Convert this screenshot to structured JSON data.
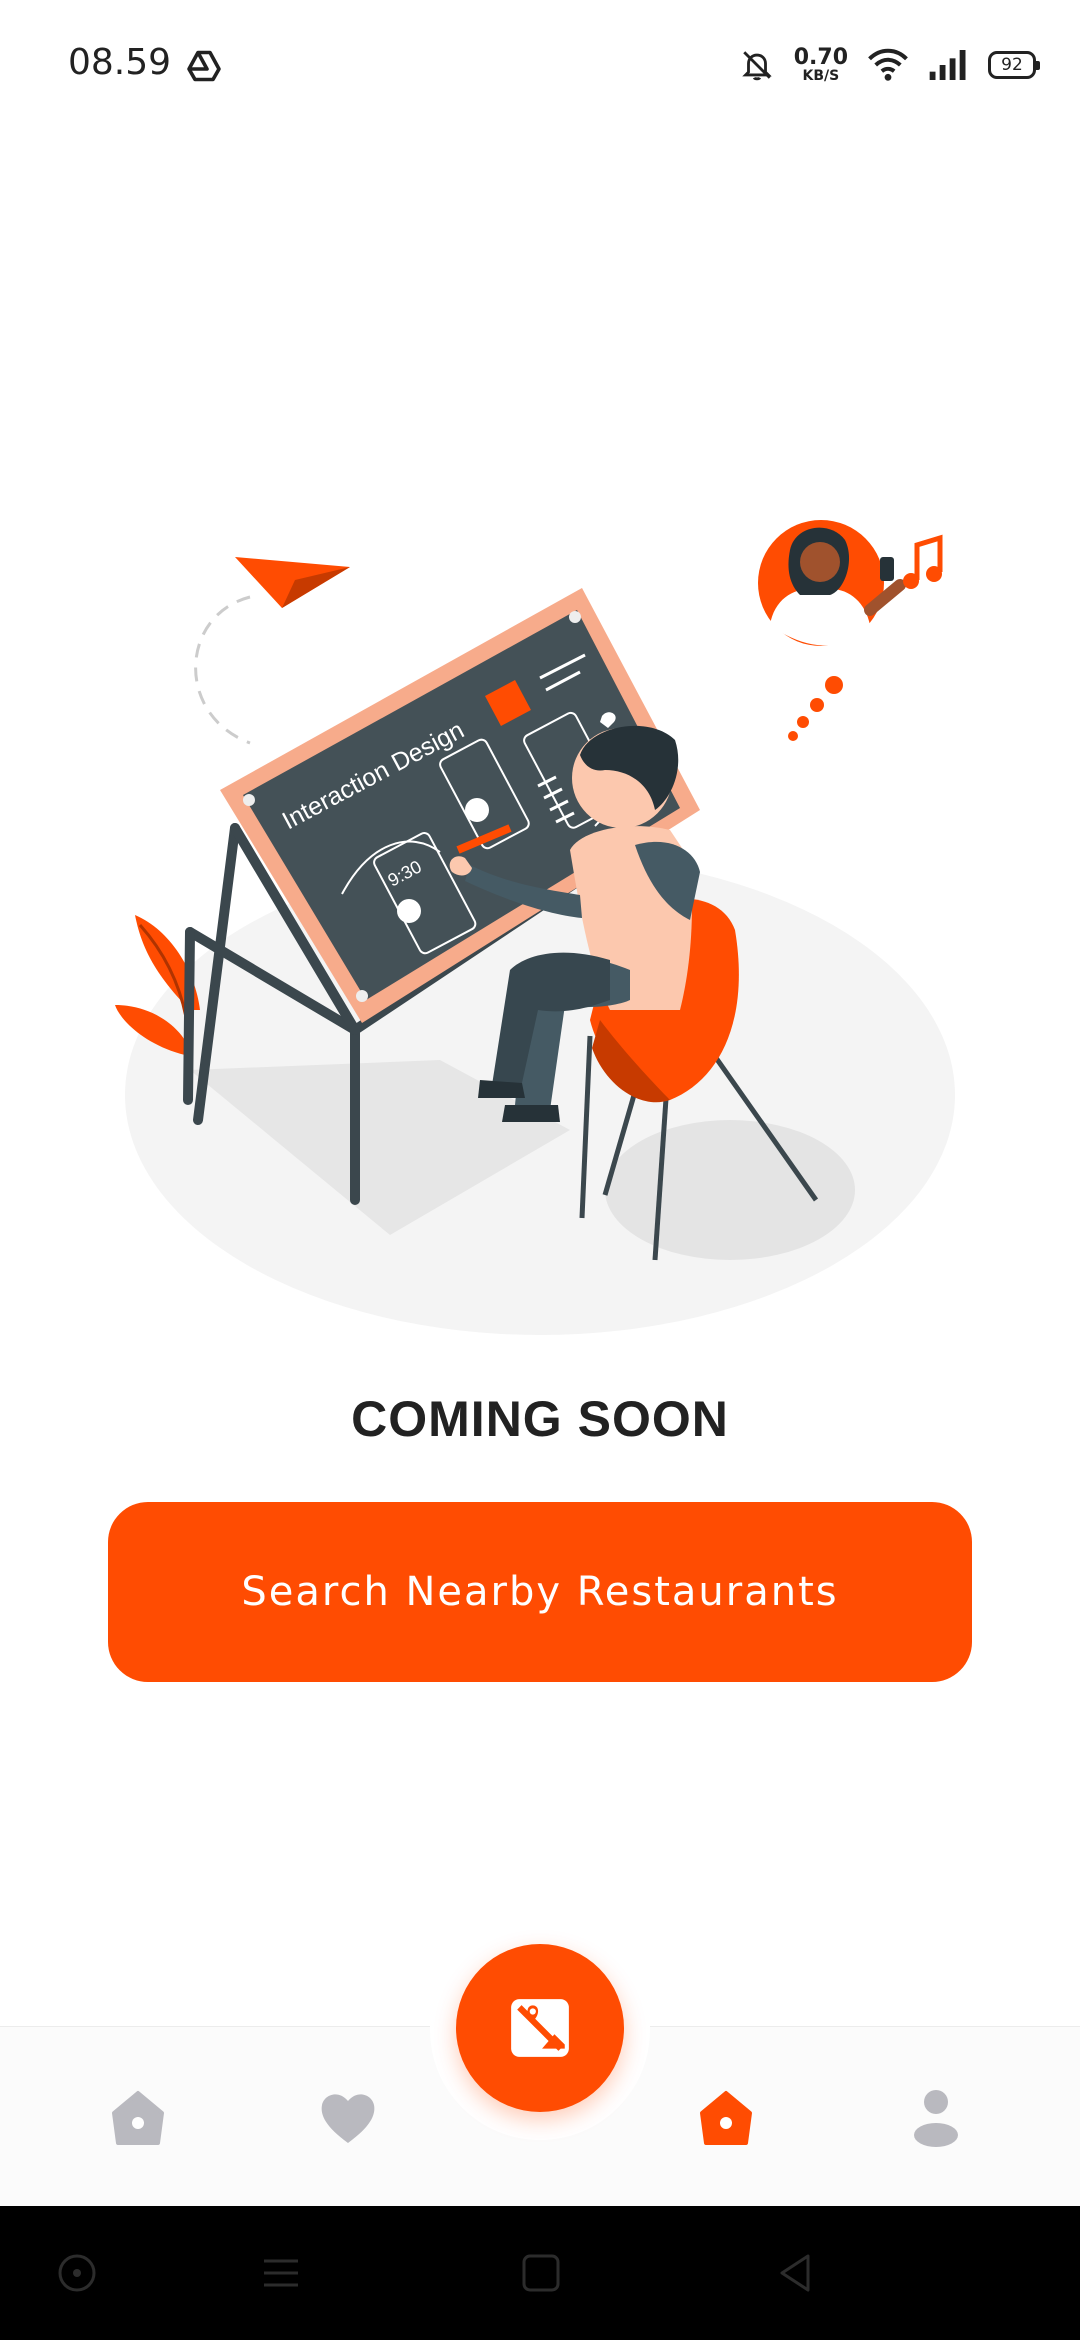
{
  "status_bar": {
    "time": "08.59",
    "network_speed_value": "0.70",
    "network_speed_unit": "KB/S",
    "battery_level": "92",
    "icons": [
      "drive-icon",
      "bell-off-icon",
      "wifi-icon",
      "signal-icon",
      "battery-icon"
    ]
  },
  "main": {
    "illustration_board_text": "Interaction Design",
    "illustration_time_text": "9:30",
    "heading": "COMING SOON",
    "cta_label": "Search Nearby Restaurants"
  },
  "bottom_nav": {
    "items": [
      {
        "icon": "home-outline-icon",
        "active": false
      },
      {
        "icon": "heart-icon",
        "active": false
      },
      {
        "icon": "gallery-icon",
        "active": true,
        "center": true
      },
      {
        "icon": "home-icon",
        "active": true
      },
      {
        "icon": "profile-icon",
        "active": false
      }
    ]
  },
  "colors": {
    "accent": "#ff4c02",
    "inactive_icon": "#b9b9bf",
    "text": "#222222",
    "board": "#445157",
    "board_frame": "#f7ab8b"
  },
  "system_nav": {
    "icons": [
      "assistant-icon",
      "menu-icon",
      "home-square-icon",
      "back-icon"
    ]
  }
}
